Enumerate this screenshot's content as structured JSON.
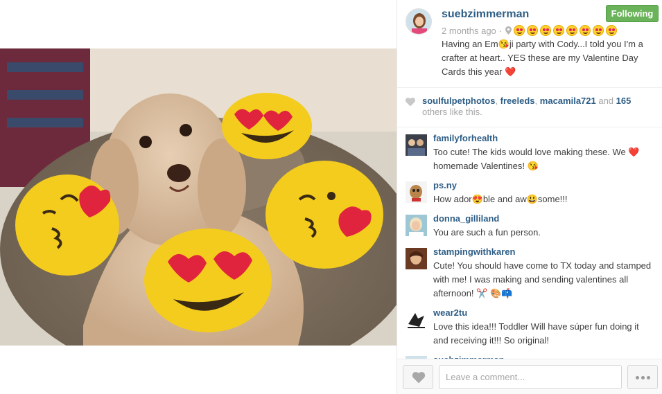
{
  "post": {
    "username": "suebzimmerman",
    "follow_label": "Following",
    "time_ago": "2 months ago ·",
    "caption": "Having an Em😘ji party with Cody...I told you I'm a crafter at heart.. YES these are my Valentine Day Cards this year",
    "caption_emoji": "❤️"
  },
  "likes": {
    "user1": "soulfulpetphotos",
    "user2": "freeleds",
    "user3": "macamila721",
    "and_text": " and ",
    "count": "165",
    "suffix": " others like this."
  },
  "comments": [
    {
      "user": "familyforhealth",
      "text": "Too cute! The kids would love making these. We ❤️ homemade Valentines! 😘"
    },
    {
      "user": "ps.ny",
      "text": "How ador😍ble and aw😃some!!!"
    },
    {
      "user": "donna_gilliland",
      "text": "You are such a fun person."
    },
    {
      "user": "stampingwithkaren",
      "text": "Cute! You should have come to TX today and stamped with me! I was making and sending valentines all afternoon! ✂️ 🎨📫"
    },
    {
      "user": "wear2tu",
      "text": "Love this idea!!! Toddler Will have súper fun doing it and receiving it!!! So original!"
    },
    {
      "user": "suebzimmerman",
      "text": ""
    }
  ],
  "footer": {
    "comment_placeholder": "Leave a comment..."
  },
  "colors": {
    "username_blue": "#2e5e86",
    "following_green": "#6bb35a",
    "muted_text": "#a5a5a5"
  },
  "icons": [
    "location-pin-icon",
    "heart-icon",
    "more-dots-icon"
  ]
}
